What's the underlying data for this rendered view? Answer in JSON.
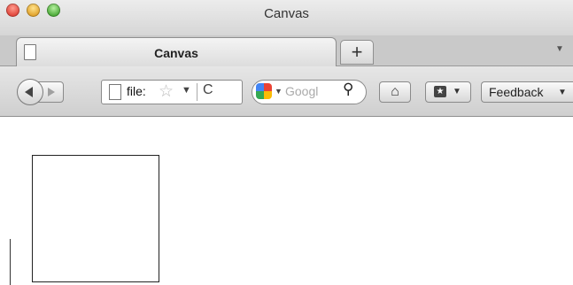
{
  "window": {
    "title": "Canvas"
  },
  "tabs": [
    {
      "label": "Canvas"
    }
  ],
  "tabstrip": {
    "new_tab_label": "+",
    "menu_glyph": "▼"
  },
  "nav": {
    "url": "file:",
    "url_dropdown_glyph": "▼",
    "reload_glyph": "C",
    "search_placeholder": "Googl",
    "search_dropdown_glyph": "▼",
    "bookmarks_dropdown_glyph": "▼",
    "feedback_label": "Feedback",
    "feedback_dropdown_glyph": "▼"
  },
  "icons": [
    "page-icon",
    "star-icon",
    "reload-icon",
    "google-icon",
    "search-icon",
    "home-icon",
    "bookmarks-icon",
    "back-arrow-icon",
    "forward-arrow-icon"
  ],
  "colors": {
    "close": "#e0443a",
    "minimize": "#e0a12a",
    "maximize": "#49a836"
  }
}
